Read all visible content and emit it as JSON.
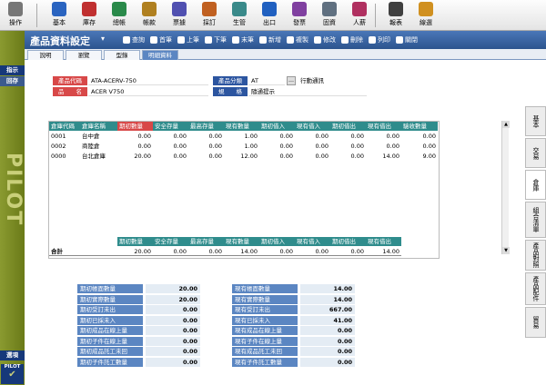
{
  "toolbar": {
    "items": [
      "操作",
      "基本",
      "庫存",
      "總帳",
      "帳款",
      "票據",
      "採訂",
      "生管",
      "出口",
      "發票",
      "固資",
      "人薪",
      "報表",
      "線選"
    ]
  },
  "sidebar": {
    "top_label": "指示",
    "second_label": "回存",
    "brand": "PILOT",
    "bottom_label": "選項",
    "logo": "PILOT"
  },
  "window": {
    "title": "產品資料設定",
    "nav": [
      "查詢",
      "首筆",
      "上筆",
      "下筆",
      "末筆",
      "新增",
      "複製",
      "修改",
      "刪除",
      "列印",
      "關閉"
    ]
  },
  "tabs": [
    "說明",
    "瀏覽",
    "型錄",
    "明細資料"
  ],
  "fields": {
    "code_label": "產品代碼",
    "code_value": "ATA-ACERV-750",
    "name_label": "品　　名",
    "name_value": "ACER V750",
    "cat_label": "產品分類",
    "cat_value": "AT",
    "cat_desc": "行動通訊",
    "spec_label": "規　　格",
    "spec_value": "隨通提示"
  },
  "table": {
    "headers": [
      "倉庫代碼",
      "倉庫名稱",
      "期初數量",
      "安全存量",
      "最高存量",
      "現有數量",
      "期初借入",
      "現有借入",
      "期初借出",
      "現有借出",
      "驗收數量"
    ],
    "rows": [
      [
        "0001",
        "台中倉",
        "0.00",
        "0.00",
        "0.00",
        "1.00",
        "0.00",
        "0.00",
        "0.00",
        "0.00",
        "0.00"
      ],
      [
        "0002",
        "商陸倉",
        "0.00",
        "0.00",
        "0.00",
        "1.00",
        "0.00",
        "0.00",
        "0.00",
        "0.00",
        "0.00"
      ],
      [
        "0000",
        "台北倉庫",
        "20.00",
        "0.00",
        "0.00",
        "12.00",
        "0.00",
        "0.00",
        "0.00",
        "14.00",
        "9.00"
      ]
    ],
    "total_headers": [
      "期初數量",
      "安全存量",
      "最高存量",
      "現有數量",
      "期初借入",
      "現有借入",
      "期初借出",
      "現有借出"
    ],
    "total_label": "合計",
    "total_values": [
      "20.00",
      "0.00",
      "0.00",
      "14.00",
      "0.00",
      "0.00",
      "0.00",
      "14.00"
    ]
  },
  "summary_left": [
    {
      "label": "期初帳面數量",
      "value": "20.00"
    },
    {
      "label": "期初實際數量",
      "value": "20.00"
    },
    {
      "label": "期初受訂未出",
      "value": "0.00"
    },
    {
      "label": "期初已採未入",
      "value": "0.00"
    },
    {
      "label": "期初成品在線上量",
      "value": "0.00"
    },
    {
      "label": "期初子件在線上量",
      "value": "0.00"
    },
    {
      "label": "期初成品託工未回",
      "value": "0.00"
    },
    {
      "label": "期初子件託工數量",
      "value": "0.00"
    }
  ],
  "summary_right": [
    {
      "label": "現有帳面數量",
      "value": "14.00"
    },
    {
      "label": "現有實際數量",
      "value": "14.00"
    },
    {
      "label": "現有受訂未出",
      "value": "667.00"
    },
    {
      "label": "現有已採未入",
      "value": "41.00"
    },
    {
      "label": "現有成品在線上量",
      "value": "0.00"
    },
    {
      "label": "現有子件在線上量",
      "value": "0.00"
    },
    {
      "label": "現有成品託工未回",
      "value": "0.00"
    },
    {
      "label": "現有子件託工數量",
      "value": "0.00"
    }
  ],
  "right_tabs": [
    "基本",
    "交易",
    "倉庫",
    "組合清單",
    "產品對照",
    "產品配件",
    "貿易"
  ]
}
